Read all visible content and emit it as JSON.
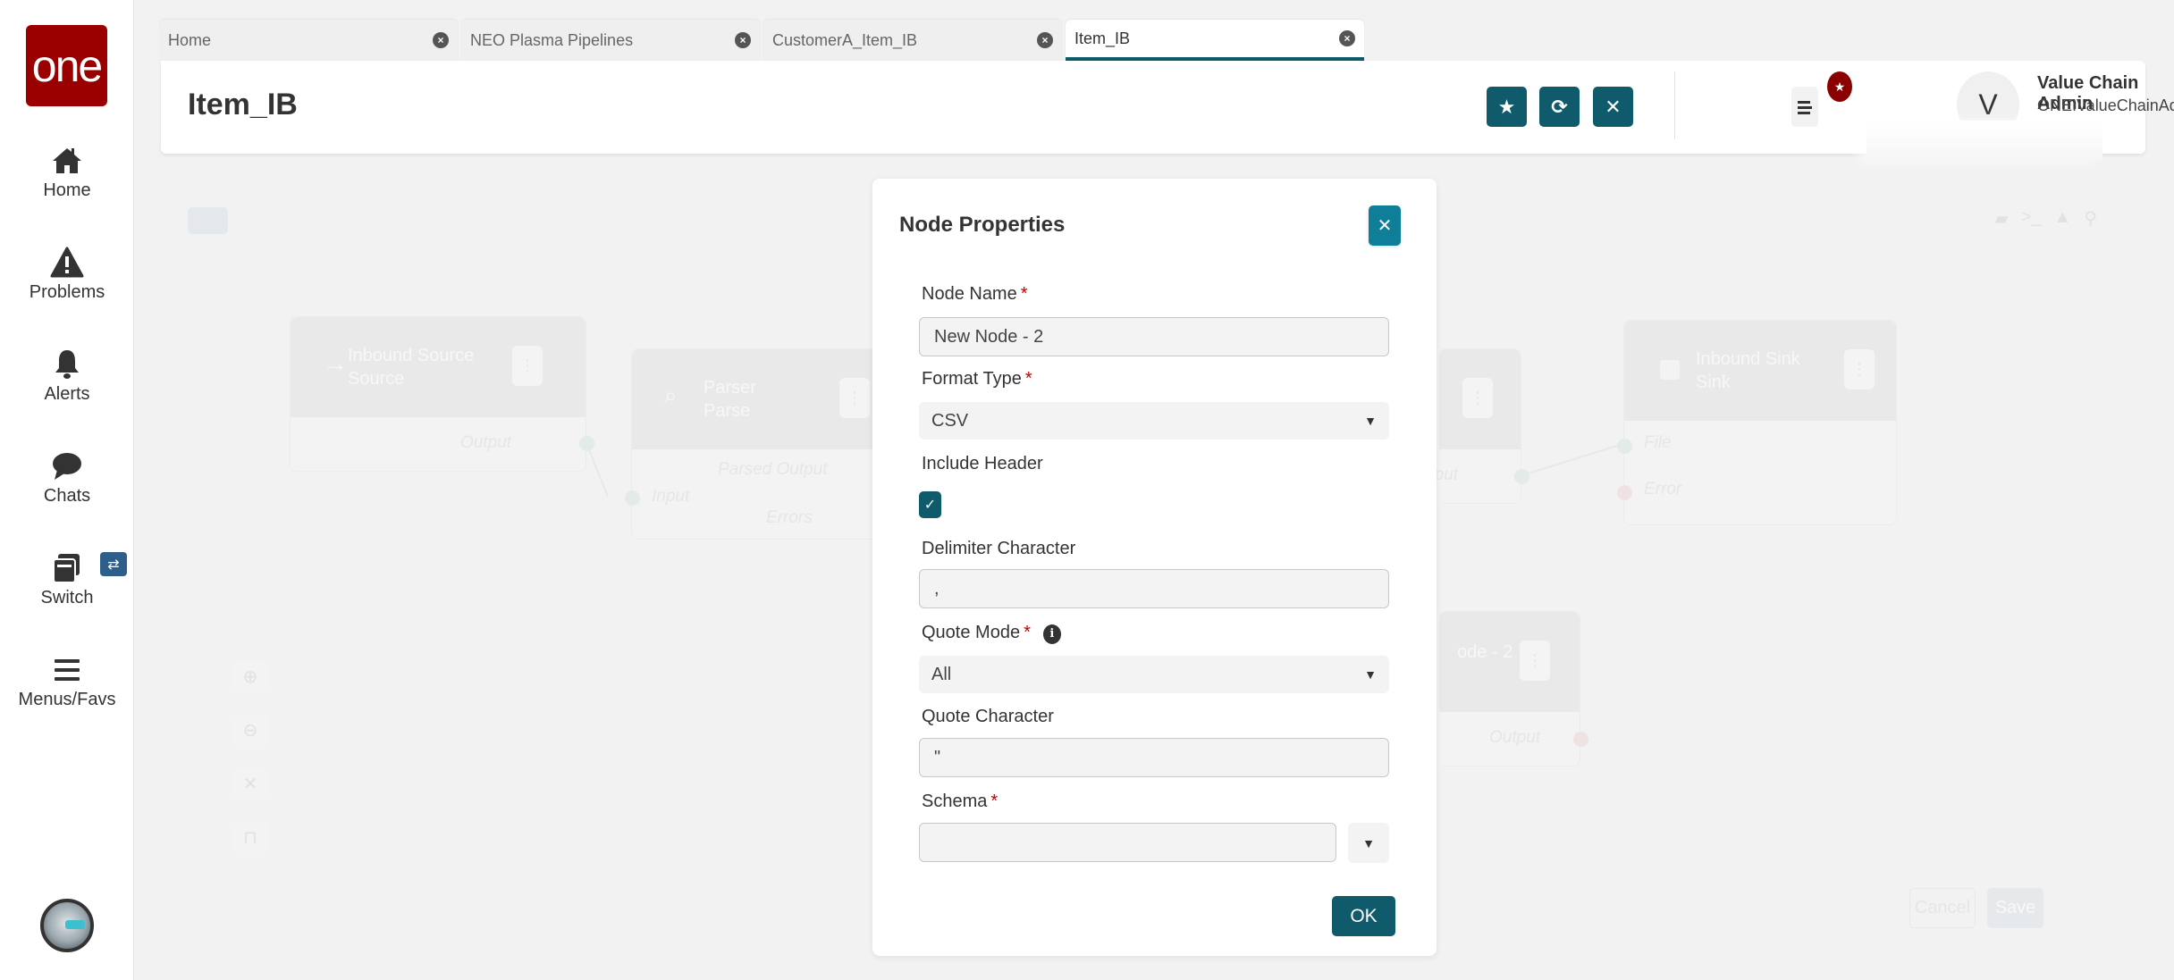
{
  "sidebar": {
    "logo_text": "one",
    "items": [
      {
        "label": "Home",
        "icon": "home-icon"
      },
      {
        "label": "Problems",
        "icon": "warning-icon"
      },
      {
        "label": "Alerts",
        "icon": "bell-icon"
      },
      {
        "label": "Chats",
        "icon": "chat-icon"
      },
      {
        "label": "Switch",
        "icon": "switch-icon"
      },
      {
        "label": "Menus/Favs",
        "icon": "menu-icon"
      }
    ],
    "switch_badge_icon": "⇄"
  },
  "tabs": [
    {
      "label": "Home",
      "active": false
    },
    {
      "label": "NEO Plasma Pipelines",
      "active": false
    },
    {
      "label": "CustomerA_Item_IB",
      "active": false
    },
    {
      "label": "Item_IB",
      "active": true
    }
  ],
  "header": {
    "title": "Item_IB",
    "user_initial": "V",
    "user_name": "Value Chain Admin",
    "user_id": "ONEIValueChainAdmin"
  },
  "canvas": {
    "nodes": [
      {
        "title": "Inbound Source",
        "subtitle": "Source",
        "ports_out": [
          "Output"
        ]
      },
      {
        "title": "Parser",
        "subtitle": "Parse",
        "ports_in": [
          "Input"
        ],
        "ports_out": [
          "Parsed Output",
          "Errors"
        ]
      },
      {
        "title": "",
        "subtitle": "",
        "ports_out": [
          "Output"
        ]
      },
      {
        "title": "Inbound Sink",
        "subtitle": "Sink",
        "ports_in": [
          "File",
          "Error"
        ]
      },
      {
        "title": "ode - 2",
        "subtitle": "",
        "ports_out": [
          "Output"
        ]
      }
    ],
    "cancel_label": "Cancel",
    "save_label": "Save"
  },
  "modal": {
    "title": "Node Properties",
    "fields": {
      "node_name": {
        "label": "Node Name",
        "required": "*",
        "value": "New Node - 2"
      },
      "format_type": {
        "label": "Format Type",
        "required": "*",
        "value": "CSV"
      },
      "include_header": {
        "label": "Include Header",
        "checked": true
      },
      "delimiter": {
        "label": "Delimiter Character",
        "value": ","
      },
      "quote_mode": {
        "label": "Quote Mode",
        "required": "*",
        "value": "All"
      },
      "quote_char": {
        "label": "Quote Character",
        "value": "\""
      },
      "schema": {
        "label": "Schema",
        "required": "*",
        "value": ""
      }
    },
    "ok_label": "OK"
  },
  "colors": {
    "brand": "#9a0000",
    "primary": "#0f5a6b",
    "close_button": "#0f7f99",
    "required": "#c00000"
  }
}
